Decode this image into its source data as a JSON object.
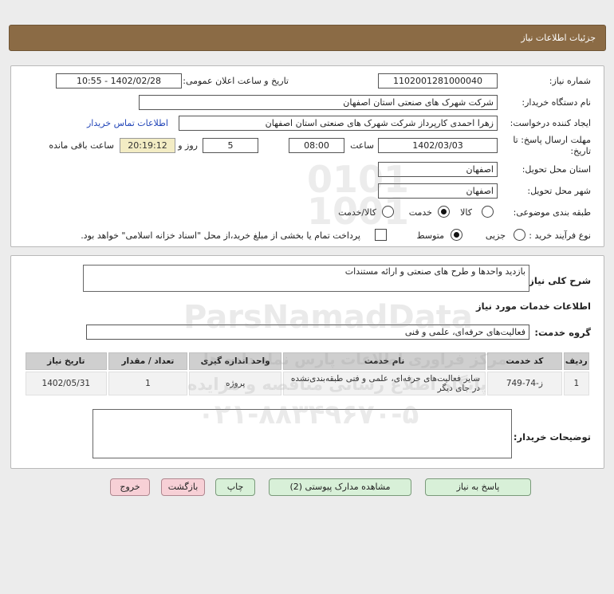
{
  "header": {
    "title": "جزئیات اطلاعات نیاز"
  },
  "form": {
    "need_number_label": "شماره نیاز:",
    "need_number": "1102001281000040",
    "announce_label": "تاریخ و ساعت اعلان عمومی:",
    "announce_value": "1402/02/28 - 10:55",
    "buyer_org_label": "نام دستگاه خریدار:",
    "buyer_org": "شرکت شهرک های صنعتی استان اصفهان",
    "requester_label": "ایجاد کننده درخواست:",
    "requester": "زهرا احمدی کارپرداز شرکت شهرک های صنعتی استان اصفهان",
    "contact_link": "اطلاعات تماس خریدار",
    "deadline_label_1": "مهلت ارسال پاسخ: تا",
    "deadline_label_2": "تاریخ:",
    "deadline_date": "1402/03/03",
    "time_label": "ساعت",
    "deadline_time": "08:00",
    "days_value": "5",
    "days_label": "روز و",
    "remaining_time": "20:19:12",
    "remaining_label": "ساعت باقی مانده",
    "delivery_province_label": "استان محل تحویل:",
    "delivery_province": "اصفهان",
    "delivery_city_label": "شهر محل تحویل:",
    "delivery_city": "اصفهان",
    "category_label": "طبقه بندی موضوعی:",
    "category_options": [
      "کالا",
      "خدمت",
      "کالا/خدمت"
    ],
    "category_selected": "خدمت",
    "process_label": "نوع فرآیند خرید :",
    "process_options": [
      "جزیی",
      "متوسط"
    ],
    "process_selected": "متوسط",
    "payment_note": "پرداخت تمام یا بخشی از مبلغ خرید،از محل \"اسناد خزانه اسلامی\" خواهد بود."
  },
  "summary": {
    "label": "شرح کلی نیاز:",
    "value": "بازدید واحدها و طرح های صنعتی و ارائه مستندات"
  },
  "services": {
    "section_title": "اطلاعات خدمات مورد نیاز",
    "group_label": "گروه خدمت:",
    "group_value": "فعالیت‌های حرفه‌ای، علمی و فنی",
    "columns": [
      "ردیف",
      "کد خدمت",
      "نام خدمت",
      "واحد اندازه گیری",
      "تعداد / مقدار",
      "تاریخ نیاز"
    ],
    "rows": [
      [
        "1",
        "ز-74-749",
        "سایر فعالیت‌های حرفه‌ای، علمی و فنی طبقه‌بندی‌نشده در جای دیگر",
        "پروژه",
        "1",
        "1402/05/31"
      ]
    ]
  },
  "buyer_notes": {
    "label": "توضیحات خریدار:",
    "value": ""
  },
  "buttons": {
    "reply": "پاسخ به نیاز",
    "attachments": "مشاهده مدارک پیوستی (2)",
    "print": "چاپ",
    "back": "بازگشت",
    "exit": "خروج"
  },
  "watermark": {
    "brand": "ParsNamadData",
    "tagline": "مرکز فراوری اطلاعات پارس نماد داده ها",
    "subline": "پایگاه اطلاع رسانی مناقصه و مزایده",
    "phone": "۰۲۱-۸۸۳۴۹۶۷۰-۵"
  },
  "colors": {
    "header_bg": "#8b6b45",
    "button_green": "#d8f0d8",
    "button_pink": "#f7d0d6",
    "link": "#2346b8"
  }
}
